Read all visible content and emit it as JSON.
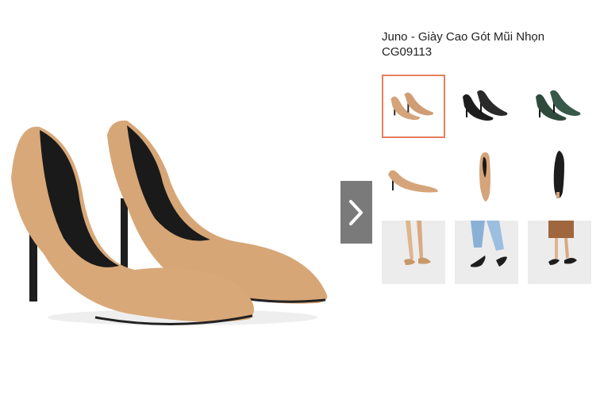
{
  "product": {
    "title": "Juno - Giày Cao Gót Mũi Nhọn CG09113",
    "colors": {
      "selected_border": "#e57f5f",
      "nude": "#d5a47a",
      "black": "#1d1d1d",
      "green": "#2f4a3d",
      "next_button": "#7a7a7a"
    }
  },
  "gallery": {
    "main_image": "nude-pointed-heels-pair",
    "next_icon": "chevron-right-icon",
    "thumbnails": [
      {
        "name": "nude pair",
        "selected": true
      },
      {
        "name": "black pair",
        "selected": false
      },
      {
        "name": "green pair",
        "selected": false
      },
      {
        "name": "nude side view",
        "selected": false
      },
      {
        "name": "nude top view",
        "selected": false
      },
      {
        "name": "black sole view",
        "selected": false
      },
      {
        "name": "worn nude with bare legs",
        "selected": false
      },
      {
        "name": "worn black with jeans",
        "selected": false
      },
      {
        "name": "worn black with skirt",
        "selected": false
      }
    ]
  }
}
